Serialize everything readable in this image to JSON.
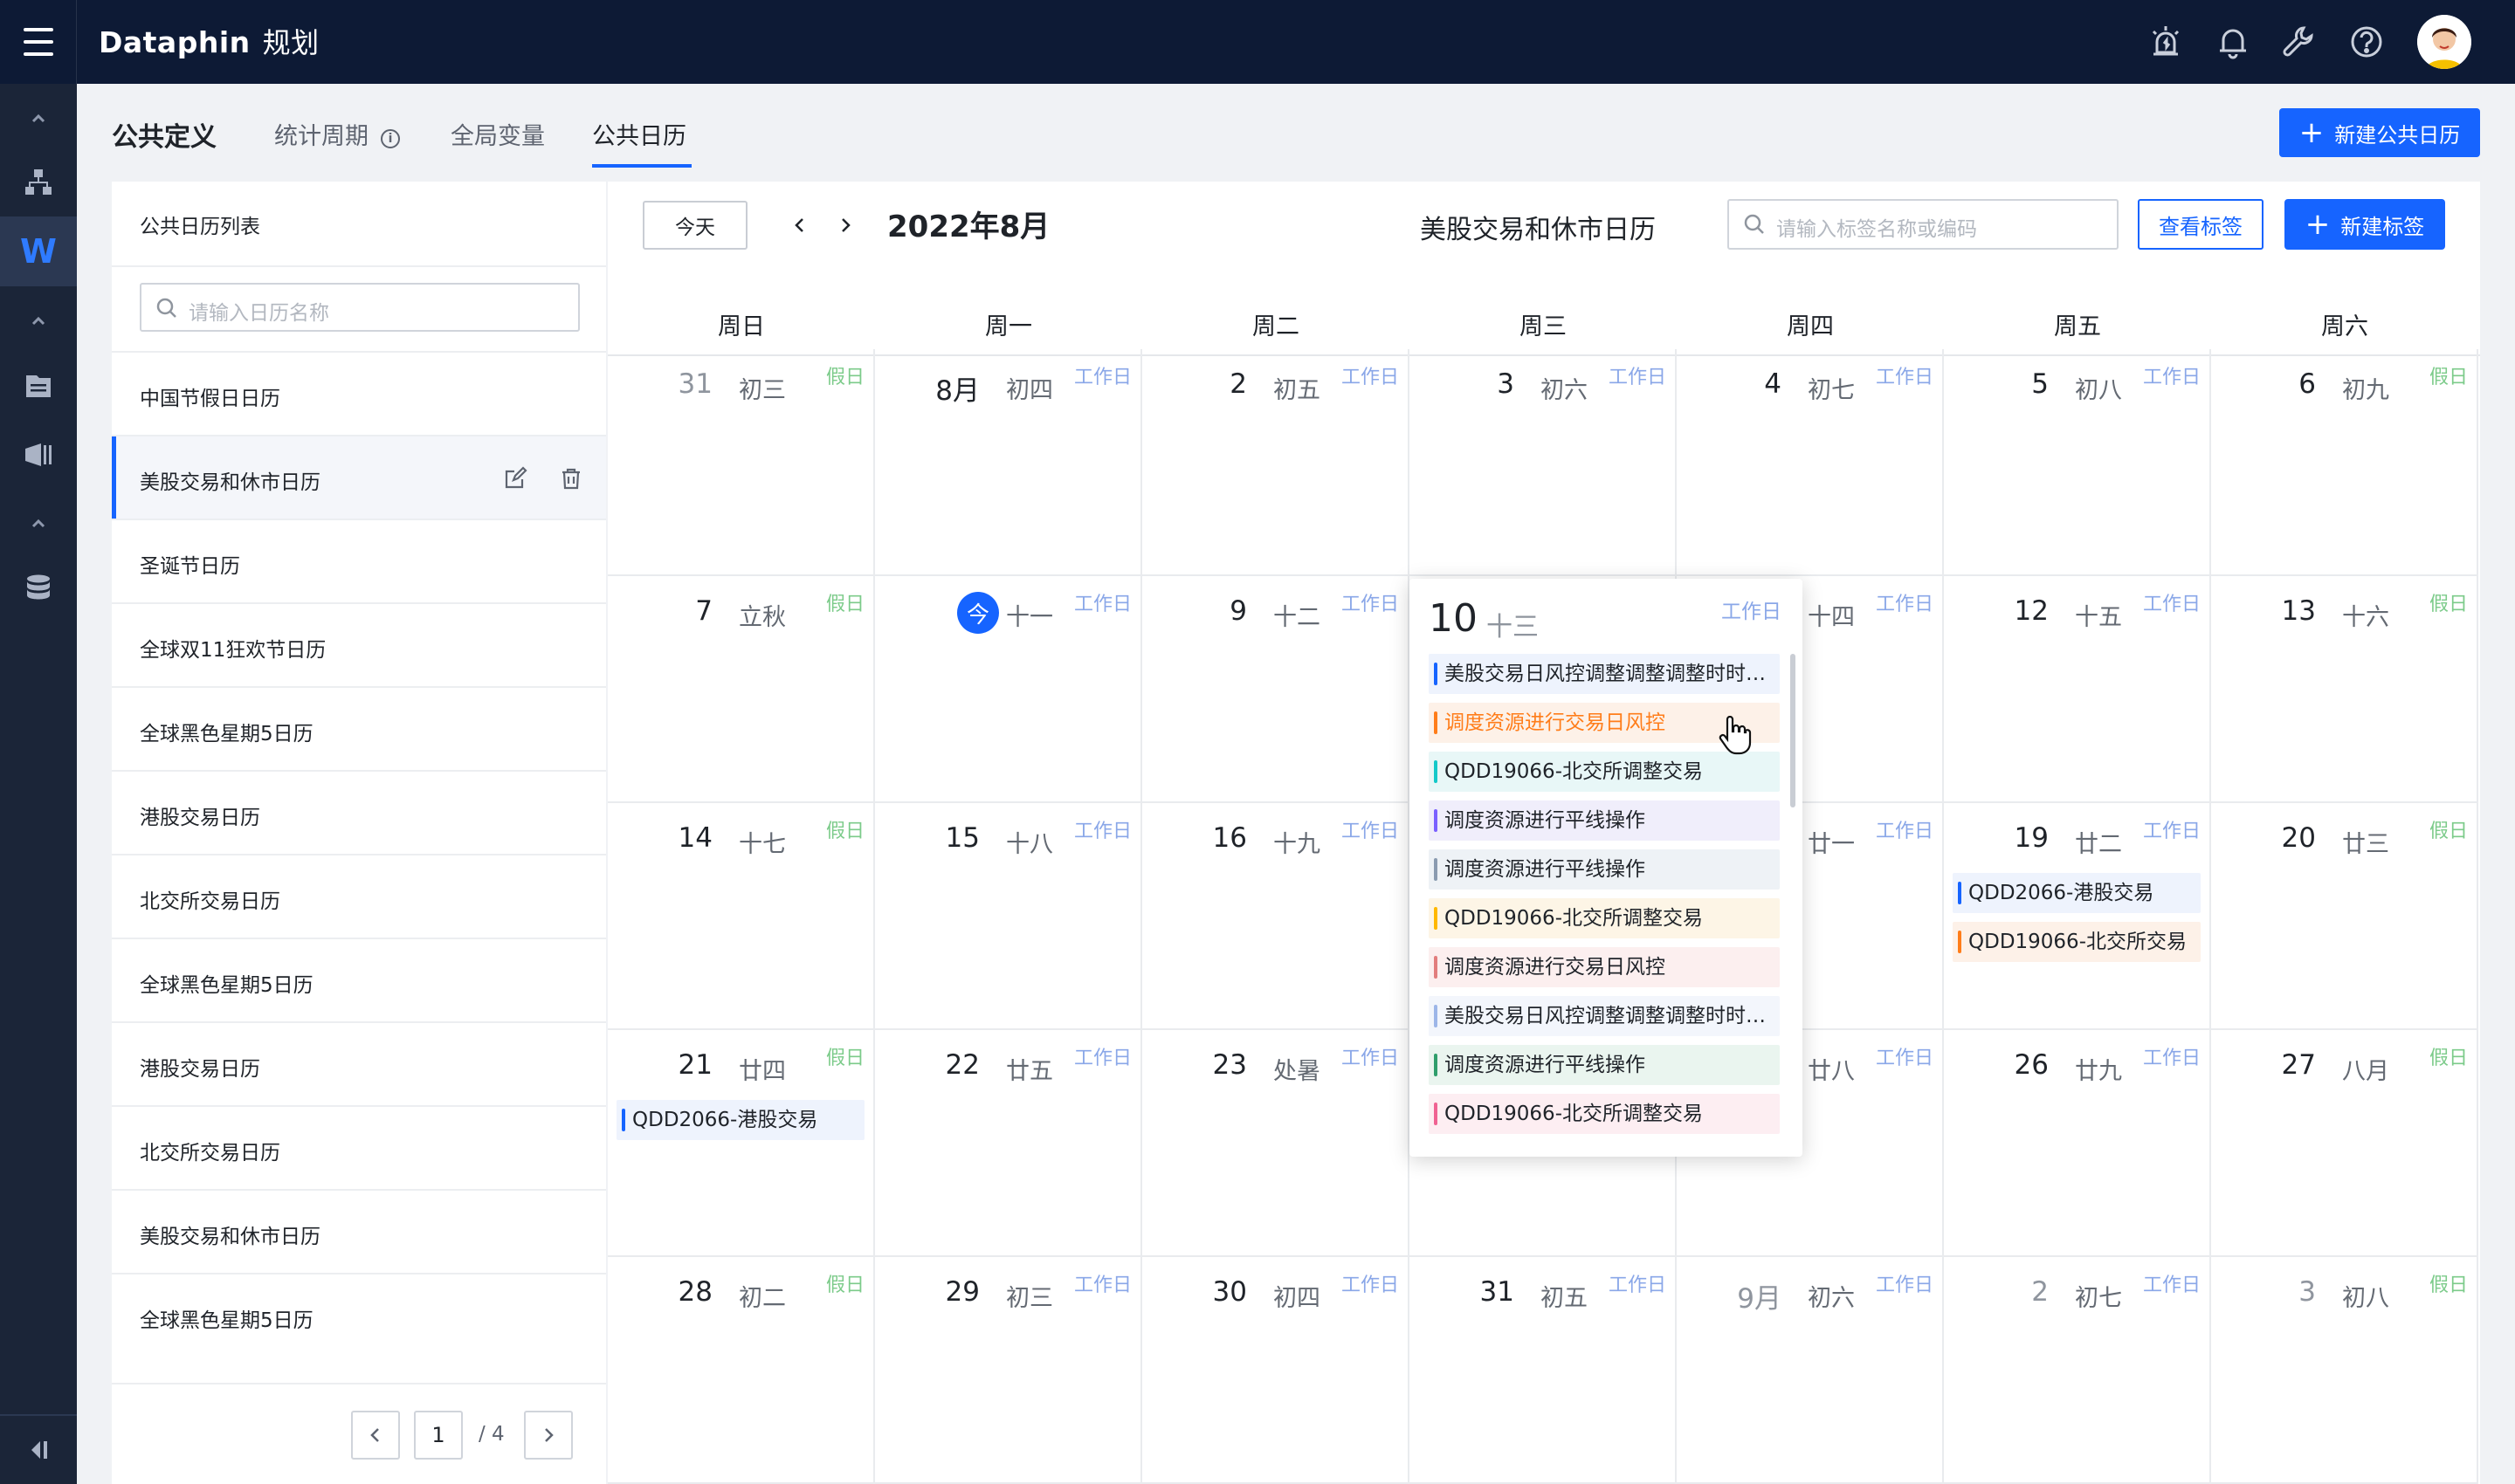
{
  "app": {
    "brand": "Dataphin",
    "module": "规划"
  },
  "header": {
    "title": "公共定义",
    "tabs": [
      {
        "label": "统计周期",
        "has_info": true
      },
      {
        "label": "全局变量"
      },
      {
        "label": "公共日历",
        "active": true
      }
    ],
    "new_calendar_button": "新建公共日历"
  },
  "sidebar": {
    "title": "公共日历列表",
    "search_placeholder": "请输入日历名称",
    "items": [
      {
        "label": "中国节假日日历"
      },
      {
        "label": "美股交易和休市日历",
        "selected": true
      },
      {
        "label": "圣诞节日历"
      },
      {
        "label": "全球双11狂欢节日历"
      },
      {
        "label": "全球黑色星期5日历"
      },
      {
        "label": "港股交易日历"
      },
      {
        "label": "北交所交易日历"
      },
      {
        "label": "全球黑色星期5日历"
      },
      {
        "label": "港股交易日历"
      },
      {
        "label": "北交所交易日历"
      },
      {
        "label": "美股交易和休市日历"
      },
      {
        "label": "全球黑色星期5日历"
      }
    ],
    "pagination": {
      "current": "1",
      "total": "/ 4"
    }
  },
  "calendar": {
    "today_button": "今天",
    "month_title": "2022年8月",
    "calendar_name": "美股交易和休市日历",
    "tag_search_placeholder": "请输入标签名称或编码",
    "view_tags_button": "查看标签",
    "new_tag_button": "新建标签",
    "today_glyph": "今",
    "weekdays": [
      "周日",
      "周一",
      "周二",
      "周三",
      "周四",
      "周五",
      "周六"
    ],
    "kinds": {
      "work": "工作日",
      "holiday": "假日"
    },
    "weeks": [
      [
        {
          "day": "31",
          "lunar": "初三",
          "kind": "holiday",
          "other": true
        },
        {
          "day": "8月",
          "lunar": "初四",
          "kind": "work"
        },
        {
          "day": "2",
          "lunar": "初五",
          "kind": "work"
        },
        {
          "day": "3",
          "lunar": "初六",
          "kind": "work"
        },
        {
          "day": "4",
          "lunar": "初七",
          "kind": "work"
        },
        {
          "day": "5",
          "lunar": "初八",
          "kind": "work"
        },
        {
          "day": "6",
          "lunar": "初九",
          "kind": "holiday"
        }
      ],
      [
        {
          "day": "7",
          "lunar": "立秋",
          "kind": "holiday"
        },
        {
          "day": "",
          "lunar": "十一",
          "kind": "work",
          "today": true
        },
        {
          "day": "9",
          "lunar": "十二",
          "kind": "work"
        },
        {
          "day": "10",
          "lunar": "十三",
          "kind": "work"
        },
        {
          "day": "",
          "lunar": "十四",
          "kind": "work"
        },
        {
          "day": "12",
          "lunar": "十五",
          "kind": "work"
        },
        {
          "day": "13",
          "lunar": "十六",
          "kind": "holiday"
        }
      ],
      [
        {
          "day": "14",
          "lunar": "十七",
          "kind": "holiday"
        },
        {
          "day": "15",
          "lunar": "十八",
          "kind": "work"
        },
        {
          "day": "16",
          "lunar": "十九",
          "kind": "work"
        },
        {
          "day": "",
          "lunar": "",
          "kind": "work"
        },
        {
          "day": "",
          "lunar": "廿一",
          "kind": "work"
        },
        {
          "day": "19",
          "lunar": "廿二",
          "kind": "work",
          "events": [
            {
              "label": "QDD2066-港股交易",
              "bar": "#1664ff",
              "bg": "#eef3fd"
            },
            {
              "label": "QDD19066-北交所交易",
              "bar": "#ff7d1a",
              "bg": "#fdf1e8"
            }
          ]
        },
        {
          "day": "20",
          "lunar": "廿三",
          "kind": "holiday"
        }
      ],
      [
        {
          "day": "21",
          "lunar": "廿四",
          "kind": "holiday",
          "events": [
            {
              "label": "QDD2066-港股交易",
              "bar": "#1664ff",
              "bg": "#eef3fd"
            }
          ]
        },
        {
          "day": "22",
          "lunar": "廿五",
          "kind": "work"
        },
        {
          "day": "23",
          "lunar": "处暑",
          "kind": "work"
        },
        {
          "day": "",
          "lunar": "",
          "kind": "work"
        },
        {
          "day": "",
          "lunar": "廿八",
          "kind": "work"
        },
        {
          "day": "26",
          "lunar": "廿九",
          "kind": "work"
        },
        {
          "day": "27",
          "lunar": "八月",
          "kind": "holiday"
        }
      ],
      [
        {
          "day": "28",
          "lunar": "初二",
          "kind": "holiday"
        },
        {
          "day": "29",
          "lunar": "初三",
          "kind": "work"
        },
        {
          "day": "30",
          "lunar": "初四",
          "kind": "work"
        },
        {
          "day": "31",
          "lunar": "初五",
          "kind": "work"
        },
        {
          "day": "9月",
          "lunar": "初六",
          "kind": "work",
          "other": true
        },
        {
          "day": "2",
          "lunar": "初七",
          "kind": "work",
          "other": true
        },
        {
          "day": "3",
          "lunar": "初八",
          "kind": "holiday",
          "other": true
        }
      ]
    ]
  },
  "popover": {
    "day": "10",
    "lunar": "十三",
    "kind": "工作日",
    "events": [
      {
        "label": "美股交易日风控调整调整调整时时…",
        "bar": "#1664ff",
        "bg": "#eef3fd"
      },
      {
        "label": "调度资源进行交易日风控",
        "bar": "#ff7d1a",
        "bg": "#fdf1e8",
        "text": "#ff7d1a"
      },
      {
        "label": "QDD19066-北交所调整交易",
        "bar": "#14c9c9",
        "bg": "#e8f7f7"
      },
      {
        "label": "调度资源进行平线操作",
        "bar": "#7b61ff",
        "bg": "#f0eefb"
      },
      {
        "label": "调度资源进行平线操作",
        "bar": "#8a9bb0",
        "bg": "#eef2f6"
      },
      {
        "label": "QDD19066-北交所调整交易",
        "bar": "#ffb800",
        "bg": "#fdf5e6"
      },
      {
        "label": "调度资源进行交易日风控",
        "bar": "#e27d7d",
        "bg": "#fcefef"
      },
      {
        "label": "美股交易日风控调整调整调整时时…",
        "bar": "#9db6e8",
        "bg": "#f3f6fc"
      },
      {
        "label": "调度资源进行平线操作",
        "bar": "#2f9e6b",
        "bg": "#eaf5ef"
      },
      {
        "label": "QDD19066-北交所调整交易",
        "bar": "#f06292",
        "bg": "#fdeef2"
      }
    ]
  },
  "colors": {
    "accent": "#1664ff",
    "topbar": "#0d1a35",
    "rail": "#1b2538"
  },
  "icons": [
    "menu-icon",
    "alarm-icon",
    "bell-icon",
    "wrench-icon",
    "help-icon",
    "avatar",
    "chevron-up-icon",
    "hierarchy-icon",
    "file-icon",
    "chart-icon",
    "database-icon",
    "collapse-icon",
    "search-icon",
    "edit-icon",
    "trash-icon",
    "chevron-left-icon",
    "chevron-right-icon",
    "plus-icon",
    "info-icon"
  ]
}
